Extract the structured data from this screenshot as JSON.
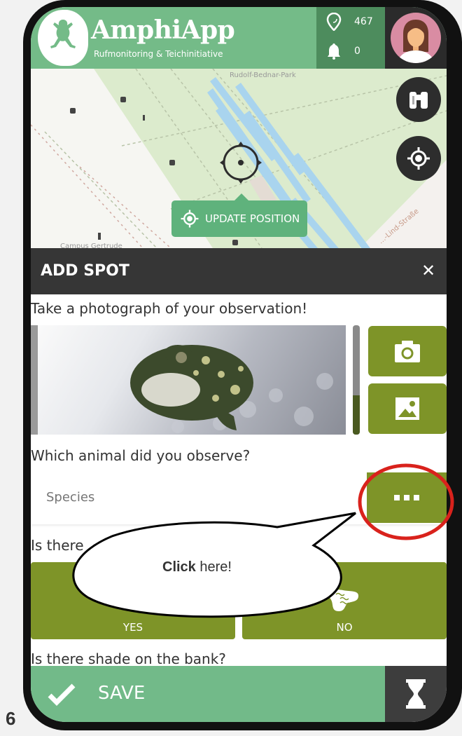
{
  "step_number": "6",
  "header": {
    "app_title": "AmphiApp",
    "app_subtitle": "Rufmonitoring & Teichinitiative",
    "spots_count": "467",
    "notifications_count": "0"
  },
  "map": {
    "labels": [
      "Rudolf-Bednar-Park",
      "Campus Gertrude",
      "…-Lind-Straße"
    ],
    "update_position_label": "UPDATE POSITION"
  },
  "panel": {
    "title": "ADD SPOT",
    "photo_question": "Take a photograph of your observation!",
    "species_question": "Which animal did you observe?",
    "species_placeholder": "Species",
    "species_value": "",
    "water_question": "Is there",
    "water_options": [
      {
        "label": "YES",
        "icon": "water-icon"
      },
      {
        "label": "NO",
        "icon": "dry-pond-icon"
      }
    ],
    "shade_question": "Is there shade on the bank?",
    "save_label": "SAVE"
  },
  "annotation": {
    "bubble_bold": "Click",
    "bubble_rest": " here!",
    "highlight_color": "#d9221c"
  },
  "colors": {
    "header_green": "#74bb88",
    "olive": "#7e9428",
    "panel_dark": "#363636"
  }
}
